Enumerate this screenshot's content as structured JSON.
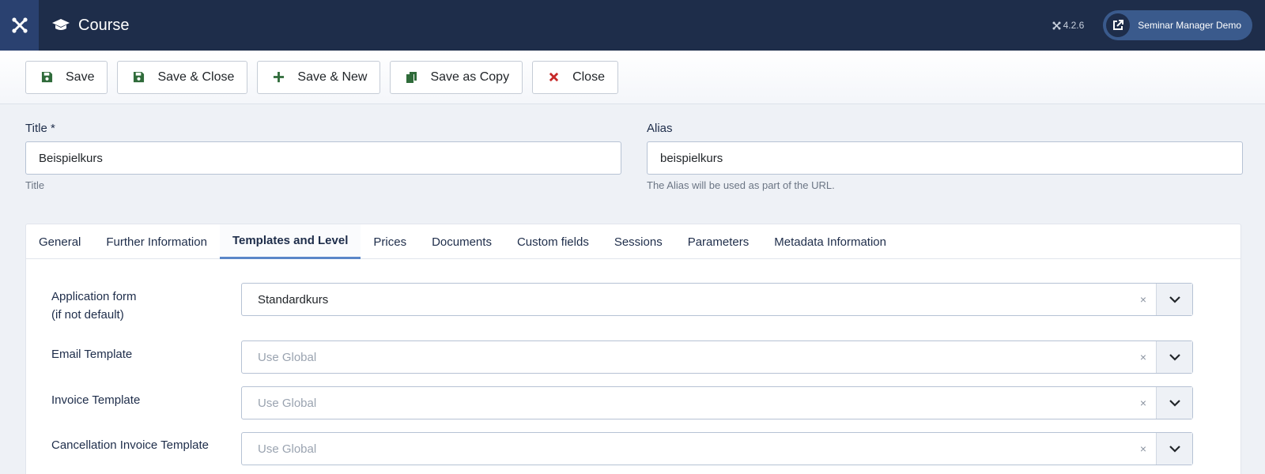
{
  "header": {
    "title": "Course",
    "version": "4.2.6",
    "site_link": "Seminar Manager Demo"
  },
  "toolbar": {
    "save": "Save",
    "save_close": "Save & Close",
    "save_new": "Save & New",
    "save_copy": "Save as Copy",
    "close": "Close"
  },
  "form": {
    "title_label": "Title *",
    "title_value": "Beispielkurs",
    "title_help": "Title",
    "alias_label": "Alias",
    "alias_value": "beispielkurs",
    "alias_help": "The Alias will be used as part of the URL."
  },
  "tabs": [
    {
      "label": "General"
    },
    {
      "label": "Further Information"
    },
    {
      "label": "Templates and Level",
      "active": true
    },
    {
      "label": "Prices"
    },
    {
      "label": "Documents"
    },
    {
      "label": "Custom fields"
    },
    {
      "label": "Sessions"
    },
    {
      "label": "Parameters"
    },
    {
      "label": "Metadata Information"
    }
  ],
  "fields": {
    "application_form": {
      "label_line1": "Application form",
      "label_line2": "(if not default)",
      "value": "Standardkurs"
    },
    "email_template": {
      "label": "Email Template",
      "value": "Use Global"
    },
    "invoice_template": {
      "label": "Invoice Template",
      "value": "Use Global"
    },
    "cancellation_template": {
      "label": "Cancellation Invoice Template",
      "value": "Use Global"
    }
  },
  "colors": {
    "header_bg": "#1e2d4a",
    "save_icon": "#2f6b3a",
    "close_icon": "#c62828",
    "active_tab": "#5a86c8"
  }
}
